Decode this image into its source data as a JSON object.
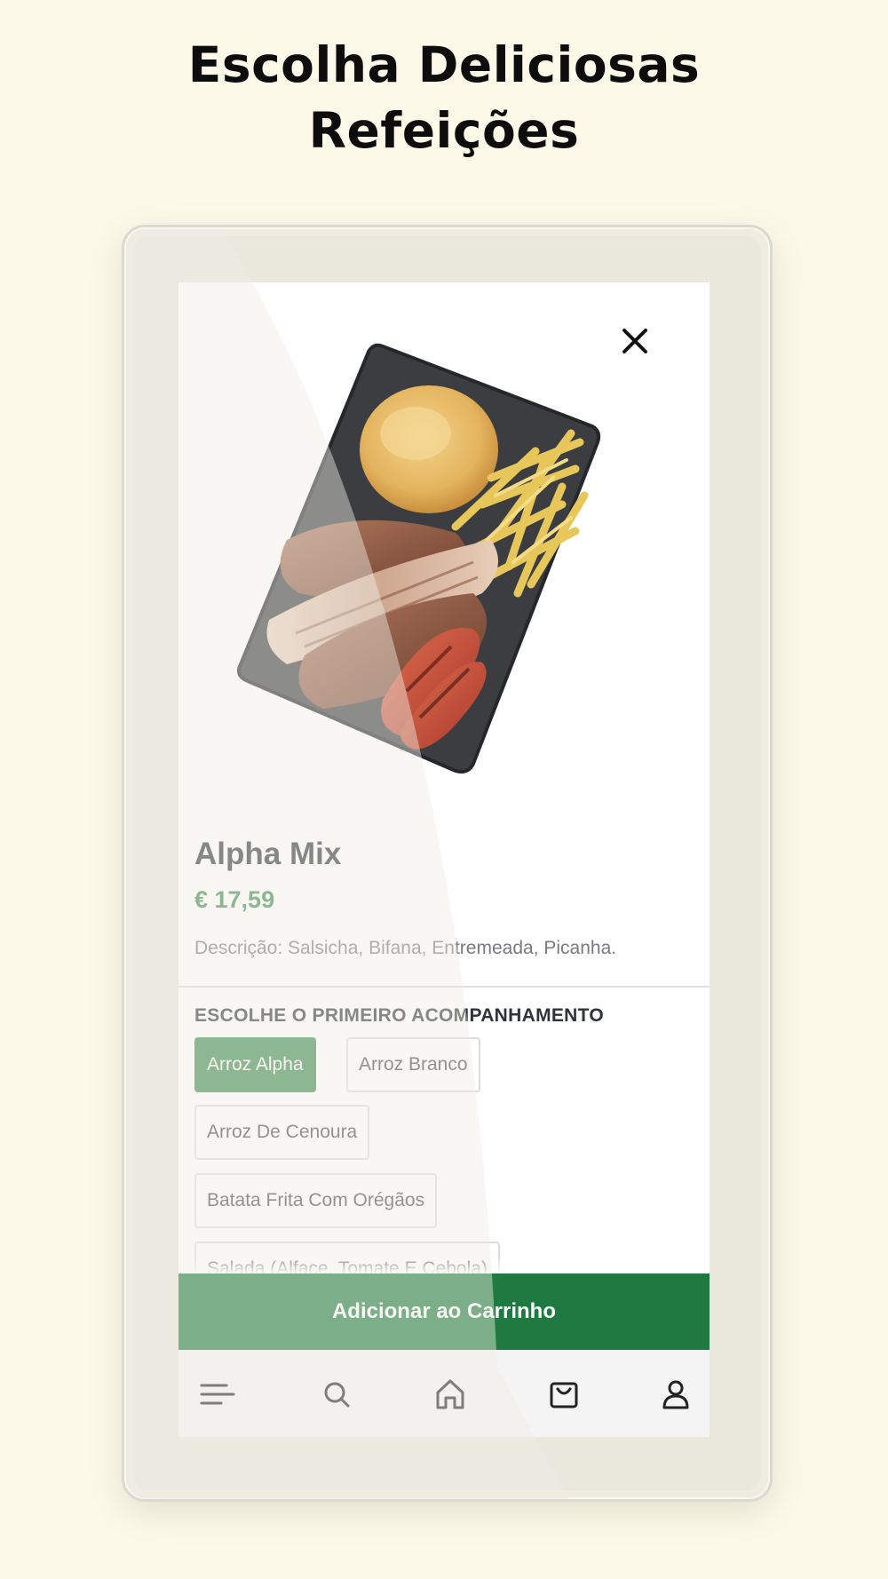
{
  "headline": {
    "line1": "Escolha Deliciosas",
    "line2": "Refeições"
  },
  "product": {
    "name": "Alpha Mix",
    "price": "€ 17,59",
    "description": "Descrição: Salsicha, Bifana, Entremeada, Picanha.",
    "image_alt": "Alpha Mix plate with rice, fries, grilled meats and sausage"
  },
  "options": {
    "section_title": "ESCOLHE O PRIMEIRO ACOMPANHAMENTO",
    "items": [
      {
        "label": "Arroz Alpha",
        "selected": true
      },
      {
        "label": "Arroz Branco",
        "selected": false
      },
      {
        "label": "Arroz De Cenoura",
        "selected": false
      },
      {
        "label": "Batata Frita Com Orégãos",
        "selected": false
      },
      {
        "label": "Salada (Alface, Tomate E Cebola)",
        "selected": false
      }
    ]
  },
  "cart": {
    "add_label": "Adicionar ao Carrinho"
  },
  "nav": {
    "items": [
      "menu-icon",
      "search-icon",
      "home-icon",
      "bag-icon",
      "user-icon"
    ]
  },
  "colors": {
    "background": "#fcf9e8",
    "accent_green": "#1e7a41",
    "price_green": "#3d8b4f",
    "chip_selected": "#3c8b4f"
  }
}
